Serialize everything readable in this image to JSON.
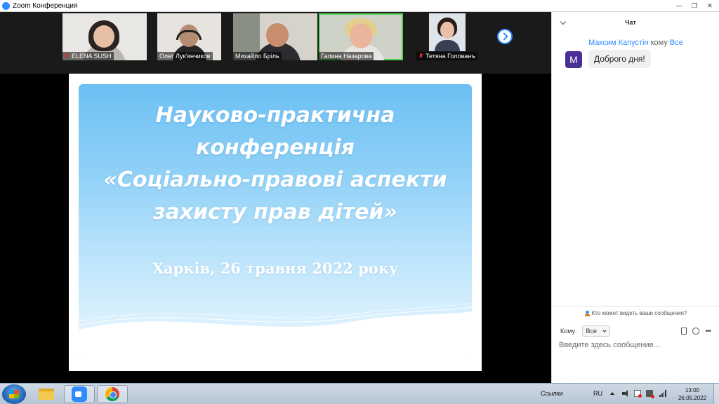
{
  "window": {
    "title": "Zoom Конференция",
    "controls": [
      "—",
      "❐",
      "✕"
    ]
  },
  "gallery": {
    "participants": [
      {
        "name": "ELENA SUSH",
        "muted": true,
        "active": false
      },
      {
        "name": "Олег Лук'янчиков",
        "muted": false,
        "active": false
      },
      {
        "name": "Михайло Бріль",
        "muted": false,
        "active": false
      },
      {
        "name": "Галина Назарова",
        "muted": false,
        "active": true
      },
      {
        "name": "Тетяна Голованъ",
        "muted": true,
        "active": false
      }
    ]
  },
  "slide": {
    "title_lines": [
      "Науково-практична",
      "конференція",
      "«Соціально-правові аспекти",
      "захисту прав дітей»"
    ],
    "subtitle": "Харків, 26 травня 2022 року"
  },
  "chat": {
    "title": "Чат",
    "message": {
      "avatar_letter": "M",
      "sender": "Максим Капустін",
      "to_word": "кому",
      "target": "Все",
      "text": "Доброго дня!"
    },
    "privacy_text": "Кто может видеть ваши сообщения?",
    "to_label": "Кому:",
    "to_value": "Все",
    "input_placeholder": "Введите здесь сообщение..."
  },
  "taskbar": {
    "links_label": "Ссылки",
    "language": "RU",
    "time": "13:00",
    "date": "26.05.2022"
  },
  "colors": {
    "zoom_blue": "#2d8cff",
    "avatar_purple": "#4a2f96",
    "active_speaker": "#54d254"
  }
}
